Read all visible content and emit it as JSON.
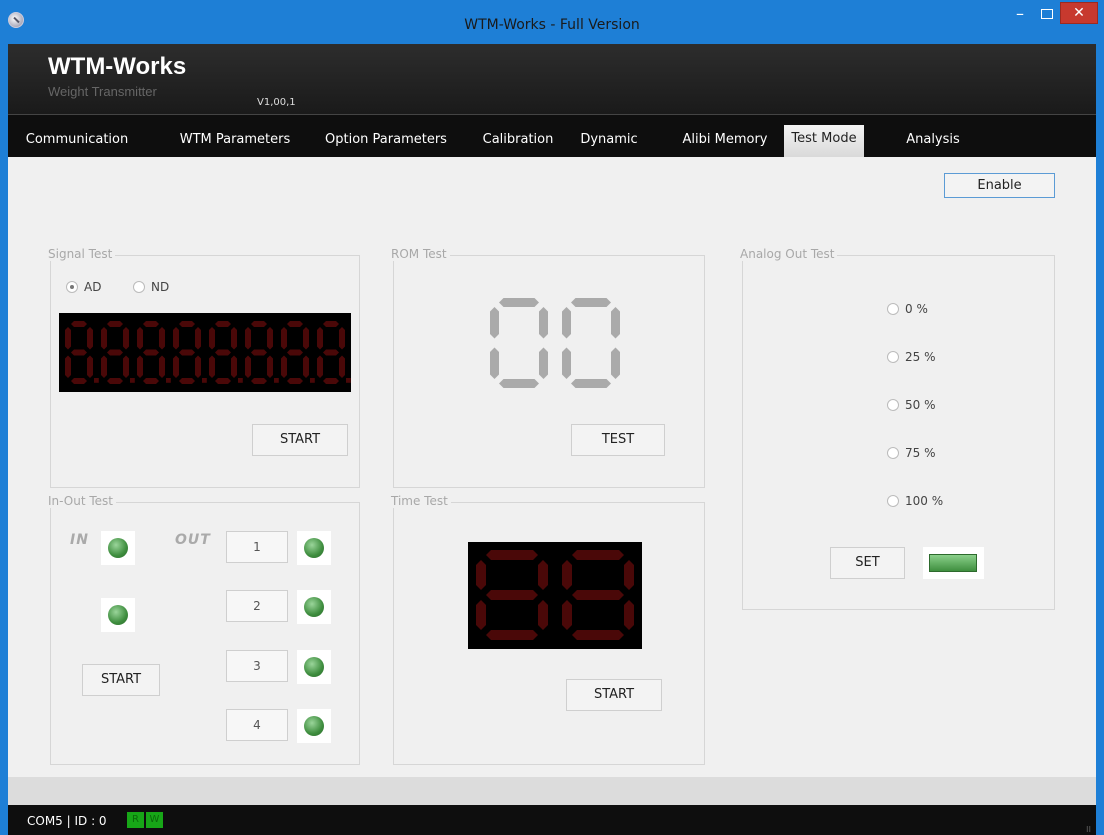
{
  "window": {
    "title": "WTM-Works - Full Version",
    "minimize": "–",
    "close": "✕"
  },
  "header": {
    "brand": "WTM-Works",
    "subtitle": "Weight Transmitter",
    "version": "V1,00,1"
  },
  "menu": {
    "tabs": [
      {
        "label": "Communication"
      },
      {
        "label": "WTM Parameters"
      },
      {
        "label": "Option Parameters"
      },
      {
        "label": "Calibration"
      },
      {
        "label": "Dynamic"
      },
      {
        "label": "Alibi Memory"
      },
      {
        "label": "Test Mode",
        "active": true
      },
      {
        "label": "Analysis"
      }
    ]
  },
  "enable_button": "Enable",
  "signal_test": {
    "title": "Signal Test",
    "options": [
      {
        "label": "AD",
        "selected": true
      },
      {
        "label": "ND",
        "selected": false
      }
    ],
    "display_value": "88888888",
    "start_button": "START"
  },
  "rom_test": {
    "title": "ROM Test",
    "display_value": "00",
    "test_button": "TEST"
  },
  "analog_out_test": {
    "title": "Analog Out Test",
    "options": [
      "0 %",
      "25 %",
      "50 %",
      "75 %",
      "100 %"
    ],
    "set_button": "SET"
  },
  "in_out_test": {
    "title": "In-Out Test",
    "in_label": "IN",
    "out_label": "OUT",
    "outputs": [
      "1",
      "2",
      "3",
      "4"
    ],
    "start_button": "START"
  },
  "time_test": {
    "title": "Time Test",
    "display_value": "88",
    "start_button": "START"
  },
  "status": {
    "text": "COM5 | ID : 0",
    "r": "R",
    "w": "W"
  },
  "colors": {
    "title_bar": "#1e7fd6",
    "led_green": "#3e8d3e",
    "seg_dim_red": "#4a0808",
    "seg_gray": "#aaaaaa"
  },
  "icons": [
    "app-icon",
    "minimize-icon",
    "maximize-icon",
    "close-icon",
    "resize-grip-icon",
    "led-indicator-icon"
  ]
}
